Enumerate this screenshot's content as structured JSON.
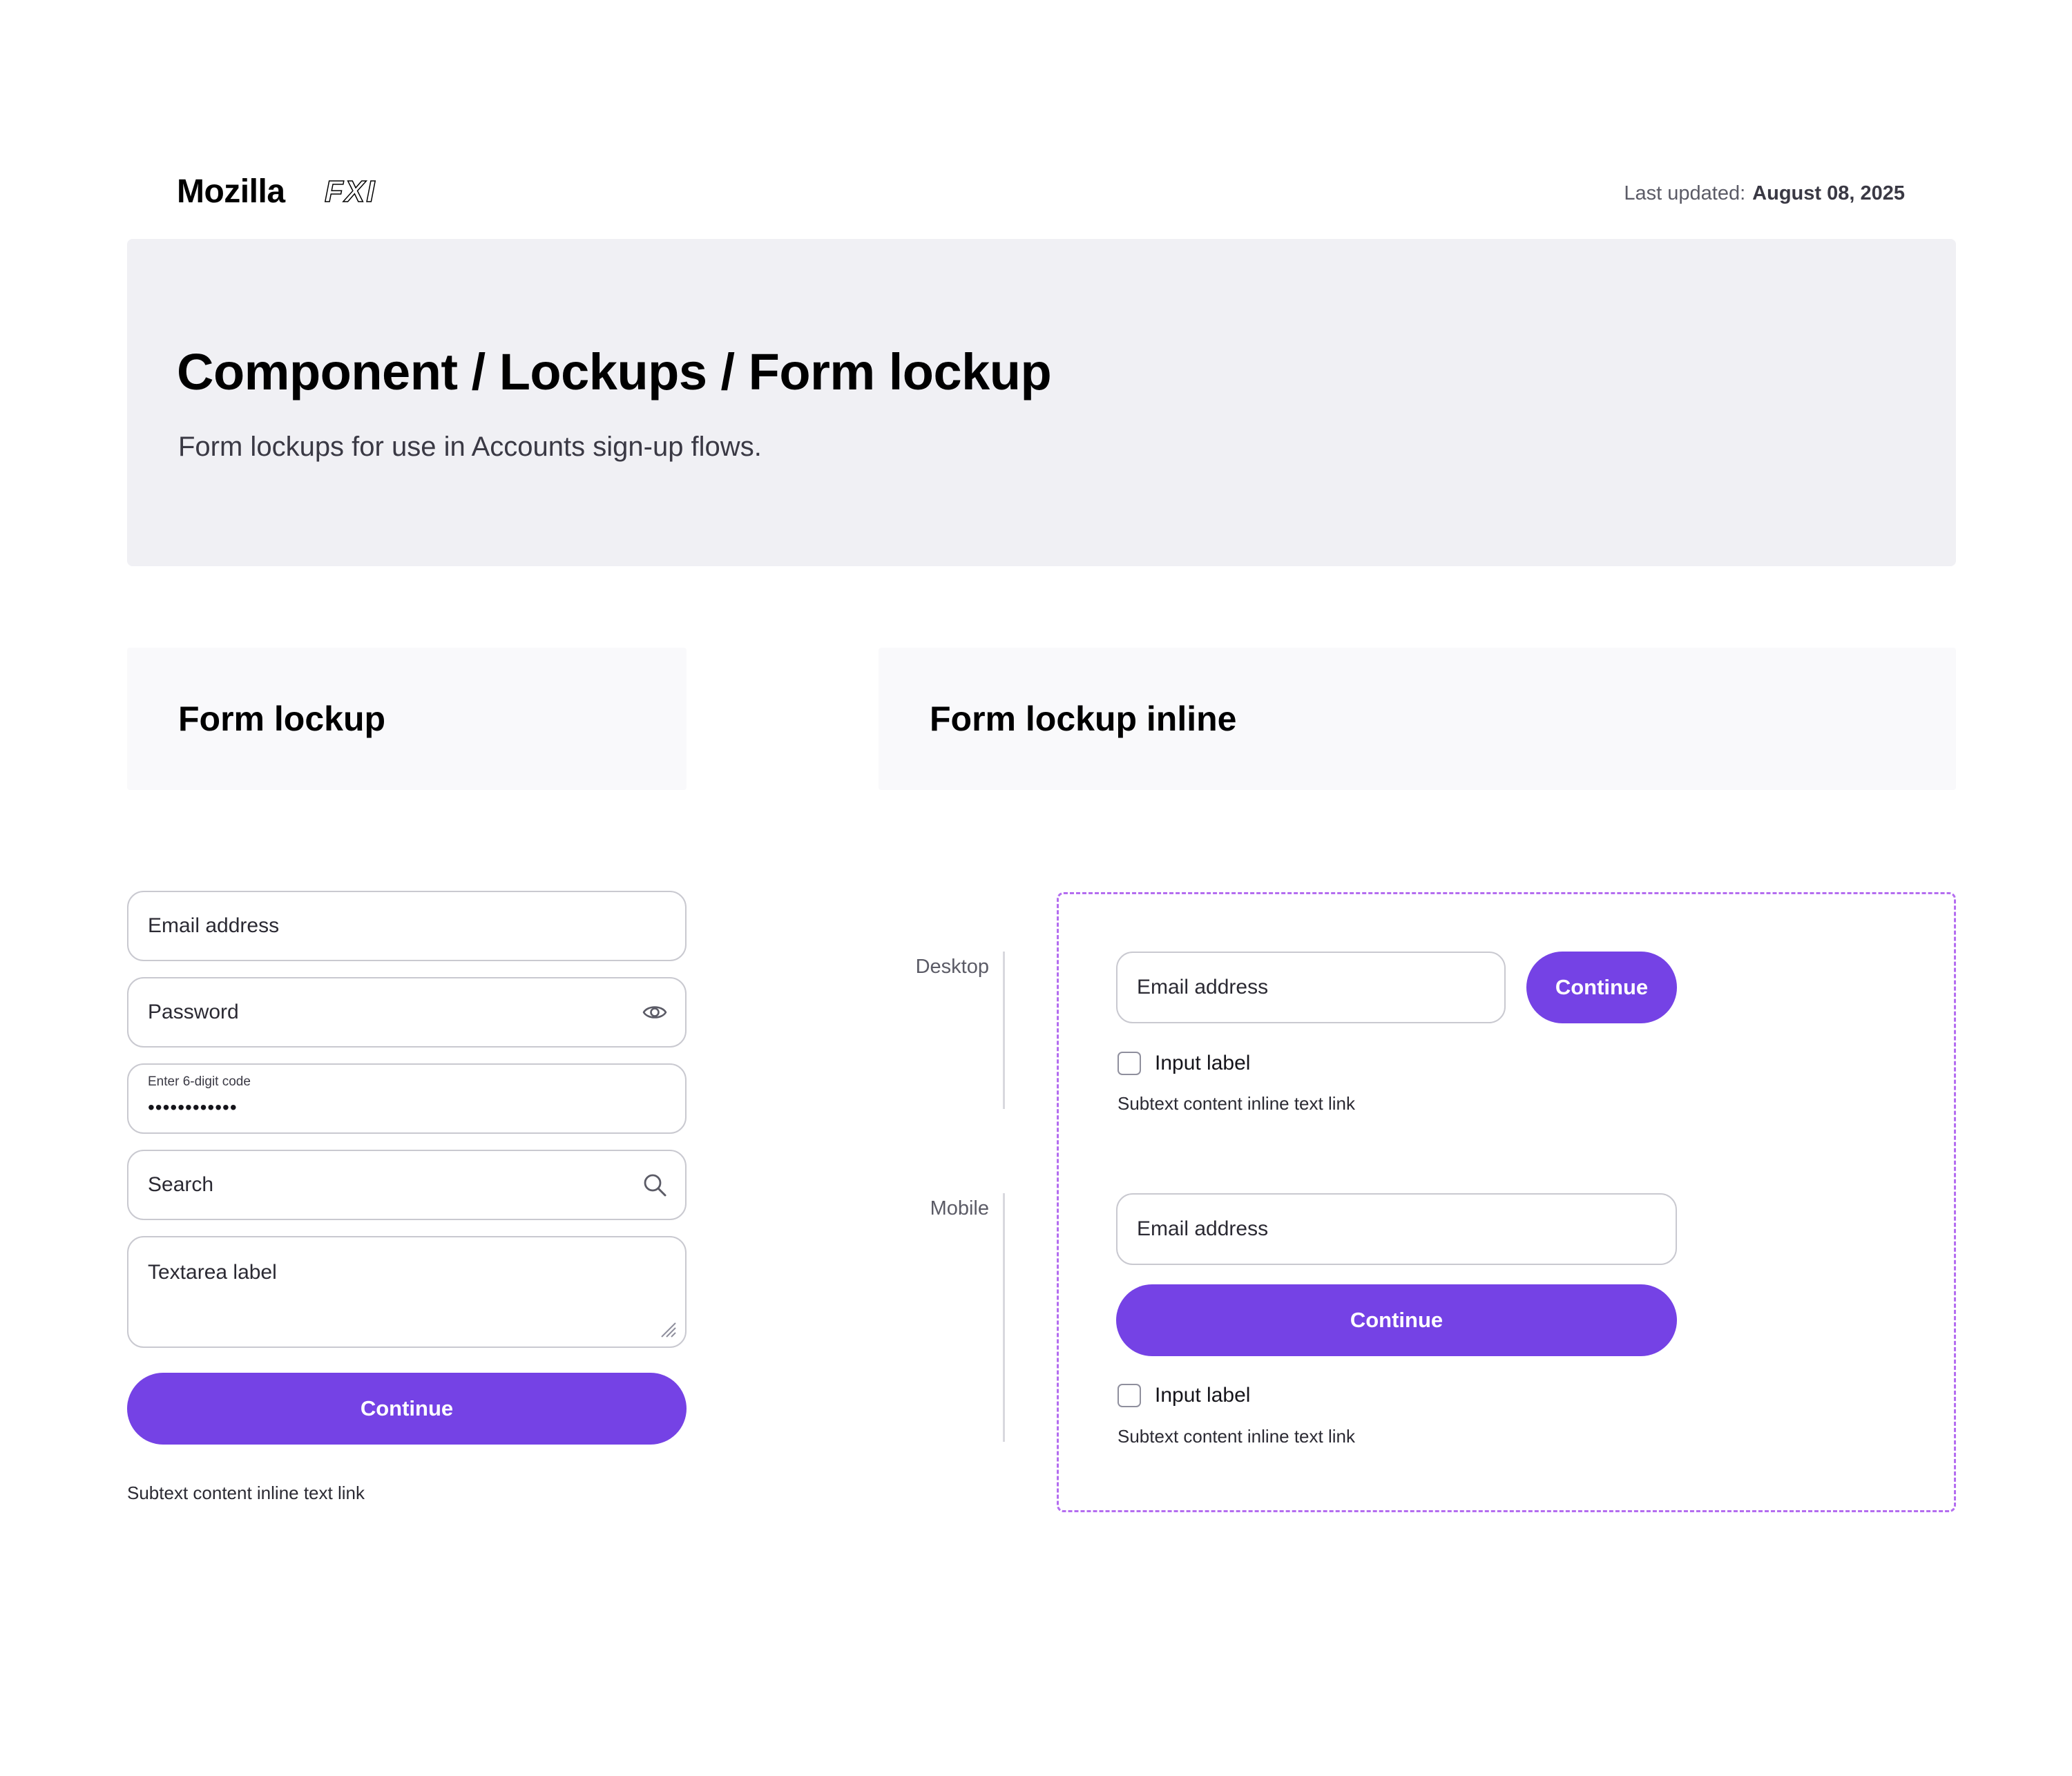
{
  "header": {
    "brand": "Mozilla",
    "brand_secondary": "FXI",
    "last_updated_label": "Last updated:",
    "last_updated_date": "August 08, 2025"
  },
  "hero": {
    "title": "Component / Lockups / Form lockup",
    "subtitle": "Form lockups for use in Accounts sign-up flows."
  },
  "form_lockup": {
    "section_title": "Form lockup",
    "email_label": "Email address",
    "password_label": "Password",
    "code_label": "Enter 6-digit code",
    "code_value": "••••••••••••",
    "search_label": "Search",
    "textarea_label": "Textarea label",
    "continue_label": "Continue",
    "subtext": "Subtext content inline text link"
  },
  "form_lockup_inline": {
    "section_title": "Form lockup inline",
    "desktop": {
      "label": "Desktop",
      "email_label": "Email address",
      "continue_label": "Continue",
      "checkbox_label": "Input label",
      "subtext": "Subtext content inline text link"
    },
    "mobile": {
      "label": "Mobile",
      "email_label": "Email address",
      "continue_label": "Continue",
      "checkbox_label": "Input label",
      "subtext": "Subtext content inline text link"
    }
  },
  "colors": {
    "accent": "#7542e5",
    "dashed_border": "#b46df0",
    "hero_bg": "#f0f0f4",
    "section_bg": "#f9f9fb"
  },
  "icons": [
    "eye-icon",
    "search-icon",
    "resize-handle-icon"
  ]
}
